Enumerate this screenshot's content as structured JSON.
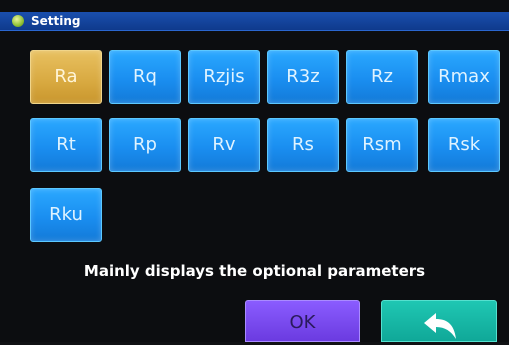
{
  "title": "Setting",
  "title_icon": "status-dot-icon",
  "parameters": [
    {
      "label": "Ra",
      "selected": true
    },
    {
      "label": "Rq",
      "selected": false
    },
    {
      "label": "Rzjis",
      "selected": false
    },
    {
      "label": "R3z",
      "selected": false
    },
    {
      "label": "Rz",
      "selected": false
    },
    {
      "label": "Rmax",
      "selected": false
    },
    {
      "label": "Rt",
      "selected": false
    },
    {
      "label": "Rp",
      "selected": false
    },
    {
      "label": "Rv",
      "selected": false
    },
    {
      "label": "Rs",
      "selected": false
    },
    {
      "label": "Rsm",
      "selected": false
    },
    {
      "label": "Rsk",
      "selected": false
    },
    {
      "label": "Rku",
      "selected": false
    }
  ],
  "caption": "Mainly displays the optional parameters",
  "ok_label": "OK",
  "back_icon": "back-arrow-icon",
  "colors": {
    "selected": "#d8a940",
    "button": "#1a8ef0",
    "ok": "#7a4cf0",
    "back": "#16b8a6",
    "titlebar": "#1a4fae"
  }
}
